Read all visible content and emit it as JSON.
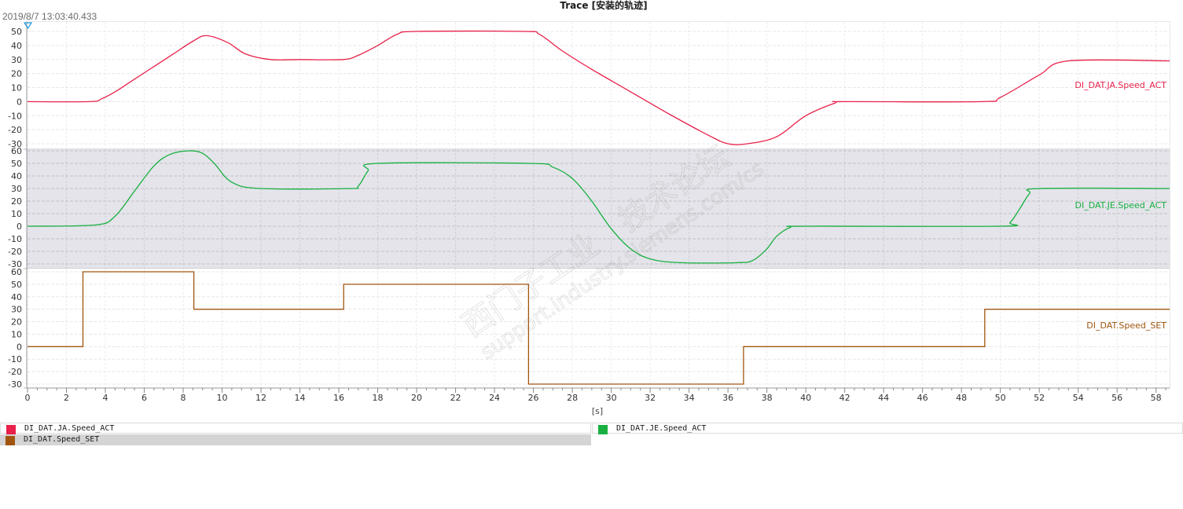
{
  "window": {
    "title": "Trace [安装的轨迹]",
    "timestamp": "2019/8/7 13:03:40.433"
  },
  "chart_data": {
    "type": "line",
    "xlabel": "[s]",
    "xlim": [
      0,
      58.7
    ],
    "x_ticks": [
      0,
      2,
      4,
      6,
      8,
      10,
      12,
      14,
      16,
      18,
      20,
      22,
      24,
      26,
      28,
      30,
      32,
      34,
      36,
      38,
      40,
      42,
      44,
      46,
      48,
      50,
      52,
      54,
      56,
      58
    ],
    "watermark": [
      "西门子工业",
      "技术论坛",
      "support.industry.siemens.com/cs"
    ],
    "panels": [
      {
        "series_name": "DI_DAT.JA.Speed_ACT",
        "color": "#e8204a",
        "ylim": [
          -30,
          50
        ],
        "y_ticks": [
          50,
          40,
          30,
          20,
          10,
          0,
          -10,
          -20,
          -30
        ],
        "highlighted": false,
        "x": [
          0,
          3.2,
          3.8,
          4.5,
          5.5,
          6.5,
          7.5,
          8.5,
          9.2,
          10.3,
          11.2,
          12.5,
          14,
          16.2,
          17,
          18,
          19,
          20,
          25.5,
          26.3,
          27.5,
          29,
          31,
          33,
          35,
          36,
          37,
          38.5,
          40,
          41.5,
          42,
          49,
          50,
          52,
          53.5,
          58.7
        ],
        "y": [
          0,
          0,
          2,
          7,
          16,
          25,
          34,
          43,
          47,
          42,
          34,
          30,
          30,
          30,
          33,
          40,
          48,
          50,
          50,
          48,
          36,
          23,
          7,
          -9,
          -24,
          -30,
          -30,
          -25,
          -10,
          -1,
          0,
          0,
          3,
          19,
          29,
          29
        ]
      },
      {
        "series_name": "DI_DAT.JE.Speed_ACT",
        "color": "#18b040",
        "ylim": [
          -30,
          60
        ],
        "y_ticks": [
          60,
          50,
          40,
          30,
          20,
          10,
          0,
          -10,
          -20,
          -30
        ],
        "highlighted": true,
        "x": [
          0,
          3.5,
          4.5,
          5.5,
          6.5,
          7.3,
          8.3,
          9,
          9.6,
          10.5,
          12,
          16.5,
          17,
          17.5,
          18,
          25.8,
          27,
          28,
          29,
          30,
          31,
          32,
          33.5,
          36.5,
          37.3,
          38,
          38.5,
          39.2,
          40,
          50,
          50.5,
          51,
          51.5,
          52,
          58.7
        ],
        "y": [
          0,
          1,
          8,
          28,
          48,
          57,
          60,
          58,
          50,
          35,
          30,
          30,
          32,
          44,
          50,
          50,
          47,
          38,
          20,
          -2,
          -18,
          -26,
          -29,
          -29,
          -27,
          -18,
          -8,
          -1,
          0,
          0,
          3,
          14,
          26,
          30,
          30
        ]
      },
      {
        "series_name": "DI_DAT.Speed_SET",
        "color": "#a0550f",
        "ylim": [
          -30,
          60
        ],
        "y_ticks": [
          60,
          50,
          40,
          30,
          20,
          10,
          0,
          -10,
          -20,
          -30
        ],
        "highlighted": false,
        "x": [
          0,
          2.85,
          2.85,
          8.55,
          8.55,
          16.25,
          16.25,
          25.75,
          25.75,
          36.8,
          36.8,
          49.2,
          49.2,
          58.7
        ],
        "y": [
          0,
          0,
          60,
          60,
          30,
          30,
          50,
          50,
          -30,
          -30,
          0,
          0,
          30,
          30
        ]
      }
    ]
  },
  "legend": {
    "items": [
      {
        "label": "DI_DAT.JA.Speed_ACT",
        "color": "#e8204a"
      },
      {
        "label": "DI_DAT.JE.Speed_ACT",
        "color": "#18b040"
      },
      {
        "label": "DI_DAT.Speed_SET",
        "color": "#a0550f"
      }
    ]
  }
}
